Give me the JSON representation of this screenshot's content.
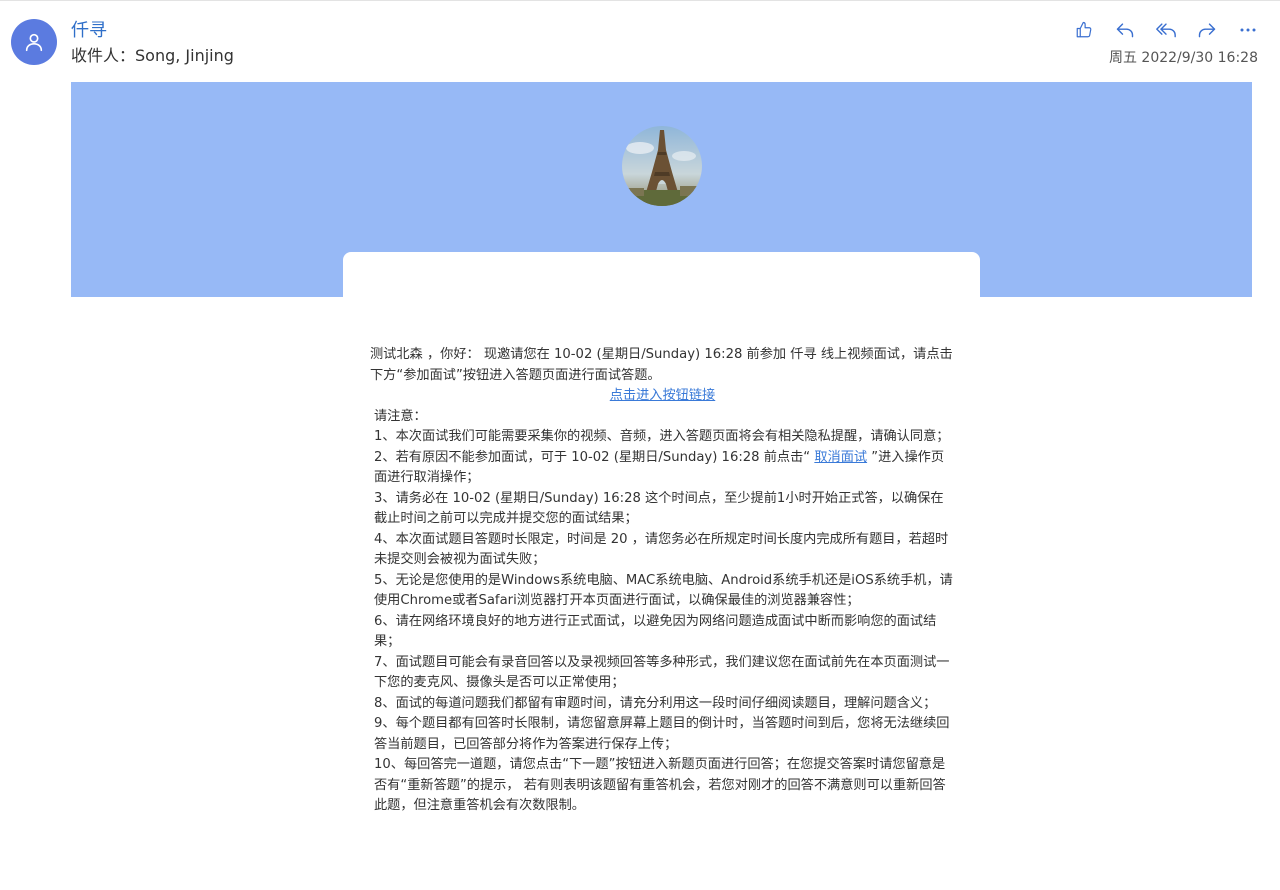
{
  "header": {
    "sender_name": "仟寻",
    "recipient": "收件人：Song, Jinjing",
    "date": "周五 2022/9/30 16:28",
    "avatar_icon": "person-icon",
    "toolbar": [
      {
        "name": "like-button",
        "icon": "thumbs-up-icon"
      },
      {
        "name": "reply-button",
        "icon": "reply-icon"
      },
      {
        "name": "reply-all-button",
        "icon": "reply-all-icon"
      },
      {
        "name": "forward-button",
        "icon": "forward-icon"
      },
      {
        "name": "more-button",
        "icon": "more-icon"
      }
    ]
  },
  "banner": {
    "color": "#97b9f6",
    "image": "eiffel-tower-photo"
  },
  "body": {
    "intro": "测试北森 ，你好：  现邀请您在 10-02 (星期日/Sunday) 16:28 前参加 仟寻 线上视频面试，请点击下方“参加面试”按钮进入答题页面进行面试答题。",
    "enter_link": "点击进入按钮链接",
    "notice_heading": "请注意：",
    "item1": "1、本次面试我们可能需要采集你的视频、音频，进入答题页面将会有相关隐私提醒，请确认同意；",
    "item2_pre": "2、若有原因不能参加面试，可于 10-02 (星期日/Sunday) 16:28 前点击“ ",
    "item2_link": "取消面试",
    "item2_post": " ”进入操作页面进行取消操作；",
    "item3": "3、请务必在 10-02 (星期日/Sunday) 16:28 这个时间点，至少提前1小时开始正式答，以确保在截止时间之前可以完成并提交您的面试结果；",
    "item4": "4、本次面试题目答题时长限定，时间是 20 ，请您务必在所规定时间长度内完成所有题目，若超时未提交则会被视为面试失败；",
    "item5": "5、无论是您使用的是Windows系统电脑、MAC系统电脑、Android系统手机还是iOS系统手机，请使用Chrome或者Safari浏览器打开本页面进行面试，以确保最佳的浏览器兼容性；",
    "item6": "6、请在网络环境良好的地方进行正式面试，以避免因为网络问题造成面试中断而影响您的面试结果；",
    "item7": "7、面试题目可能会有录音回答以及录视频回答等多种形式，我们建议您在面试前先在本页面测试一下您的麦克风、摄像头是否可以正常使用；",
    "item8": "8、面试的每道问题我们都留有审题时间，请充分利用这一段时间仔细阅读题目，理解问题含义；",
    "item9": "9、每个题目都有回答时长限制，请您留意屏幕上题目的倒计时，当答题时间到后，您将无法继续回答当前题目，已回答部分将作为答案进行保存上传；",
    "item10": "10、每回答完一道题，请您点击“下一题”按钮进入新题页面进行回答；在您提交答案时请您留意是否有“重新答题”的提示， 若有则表明该题留有重答机会，若您对刚才的回答不满意则可以重新回答此题，但注意重答机会有次数限制。"
  }
}
